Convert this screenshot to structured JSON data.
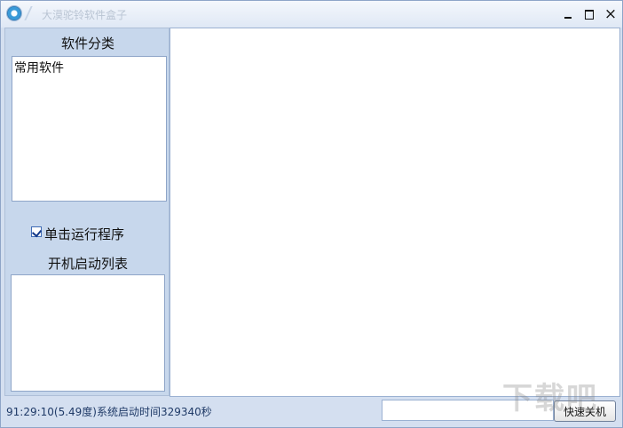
{
  "window": {
    "title": "大漠驼铃软件盒子",
    "controls": {
      "minimize": "minimize",
      "maximize": "maximize",
      "close": "×"
    }
  },
  "sidebar": {
    "category_title": "软件分类",
    "categories": [
      "常用软件"
    ],
    "checkbox": {
      "label": "单击运行程序",
      "checked": true
    },
    "boot_title": "开机启动列表"
  },
  "statusbar": {
    "time": "91:29:10(5.49度)",
    "boot_info": "系统启动时间329340秒",
    "shutdown_button": "快速关机",
    "shutdown_input": ""
  },
  "watermark": {
    "text": "下载吧"
  },
  "colors": {
    "frame": "#8ea5c8",
    "sidebar": "#c7d7ec",
    "status_text": "#1f3a67"
  },
  "icons": {
    "app": "app-logo-icon",
    "check": "checkmark-icon",
    "minimize": "minimize-icon",
    "maximize": "maximize-icon",
    "close": "close-icon"
  }
}
